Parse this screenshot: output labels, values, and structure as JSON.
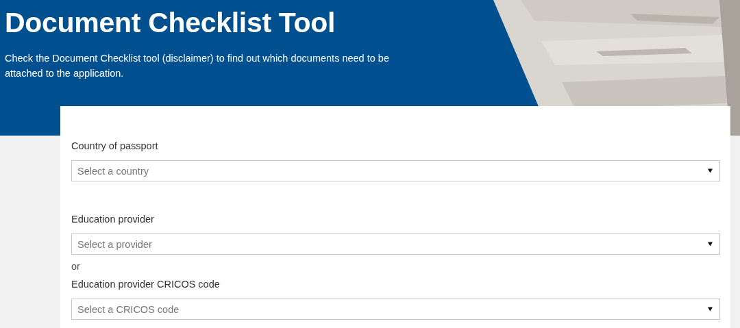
{
  "header": {
    "title": "Document Checklist Tool",
    "intro": "Check the Document Checklist tool (disclaimer) to find out which documents need to be attached to the application."
  },
  "form": {
    "items": [
      {
        "kind": "select",
        "label": "Country of passport",
        "placeholder": "Select a country"
      },
      {
        "kind": "select",
        "label": "Education provider",
        "placeholder": "Select a provider"
      },
      {
        "kind": "separator",
        "text": "or"
      },
      {
        "kind": "select",
        "label": "Education provider CRICOS code",
        "placeholder": "Select a CRICOS code"
      }
    ]
  }
}
